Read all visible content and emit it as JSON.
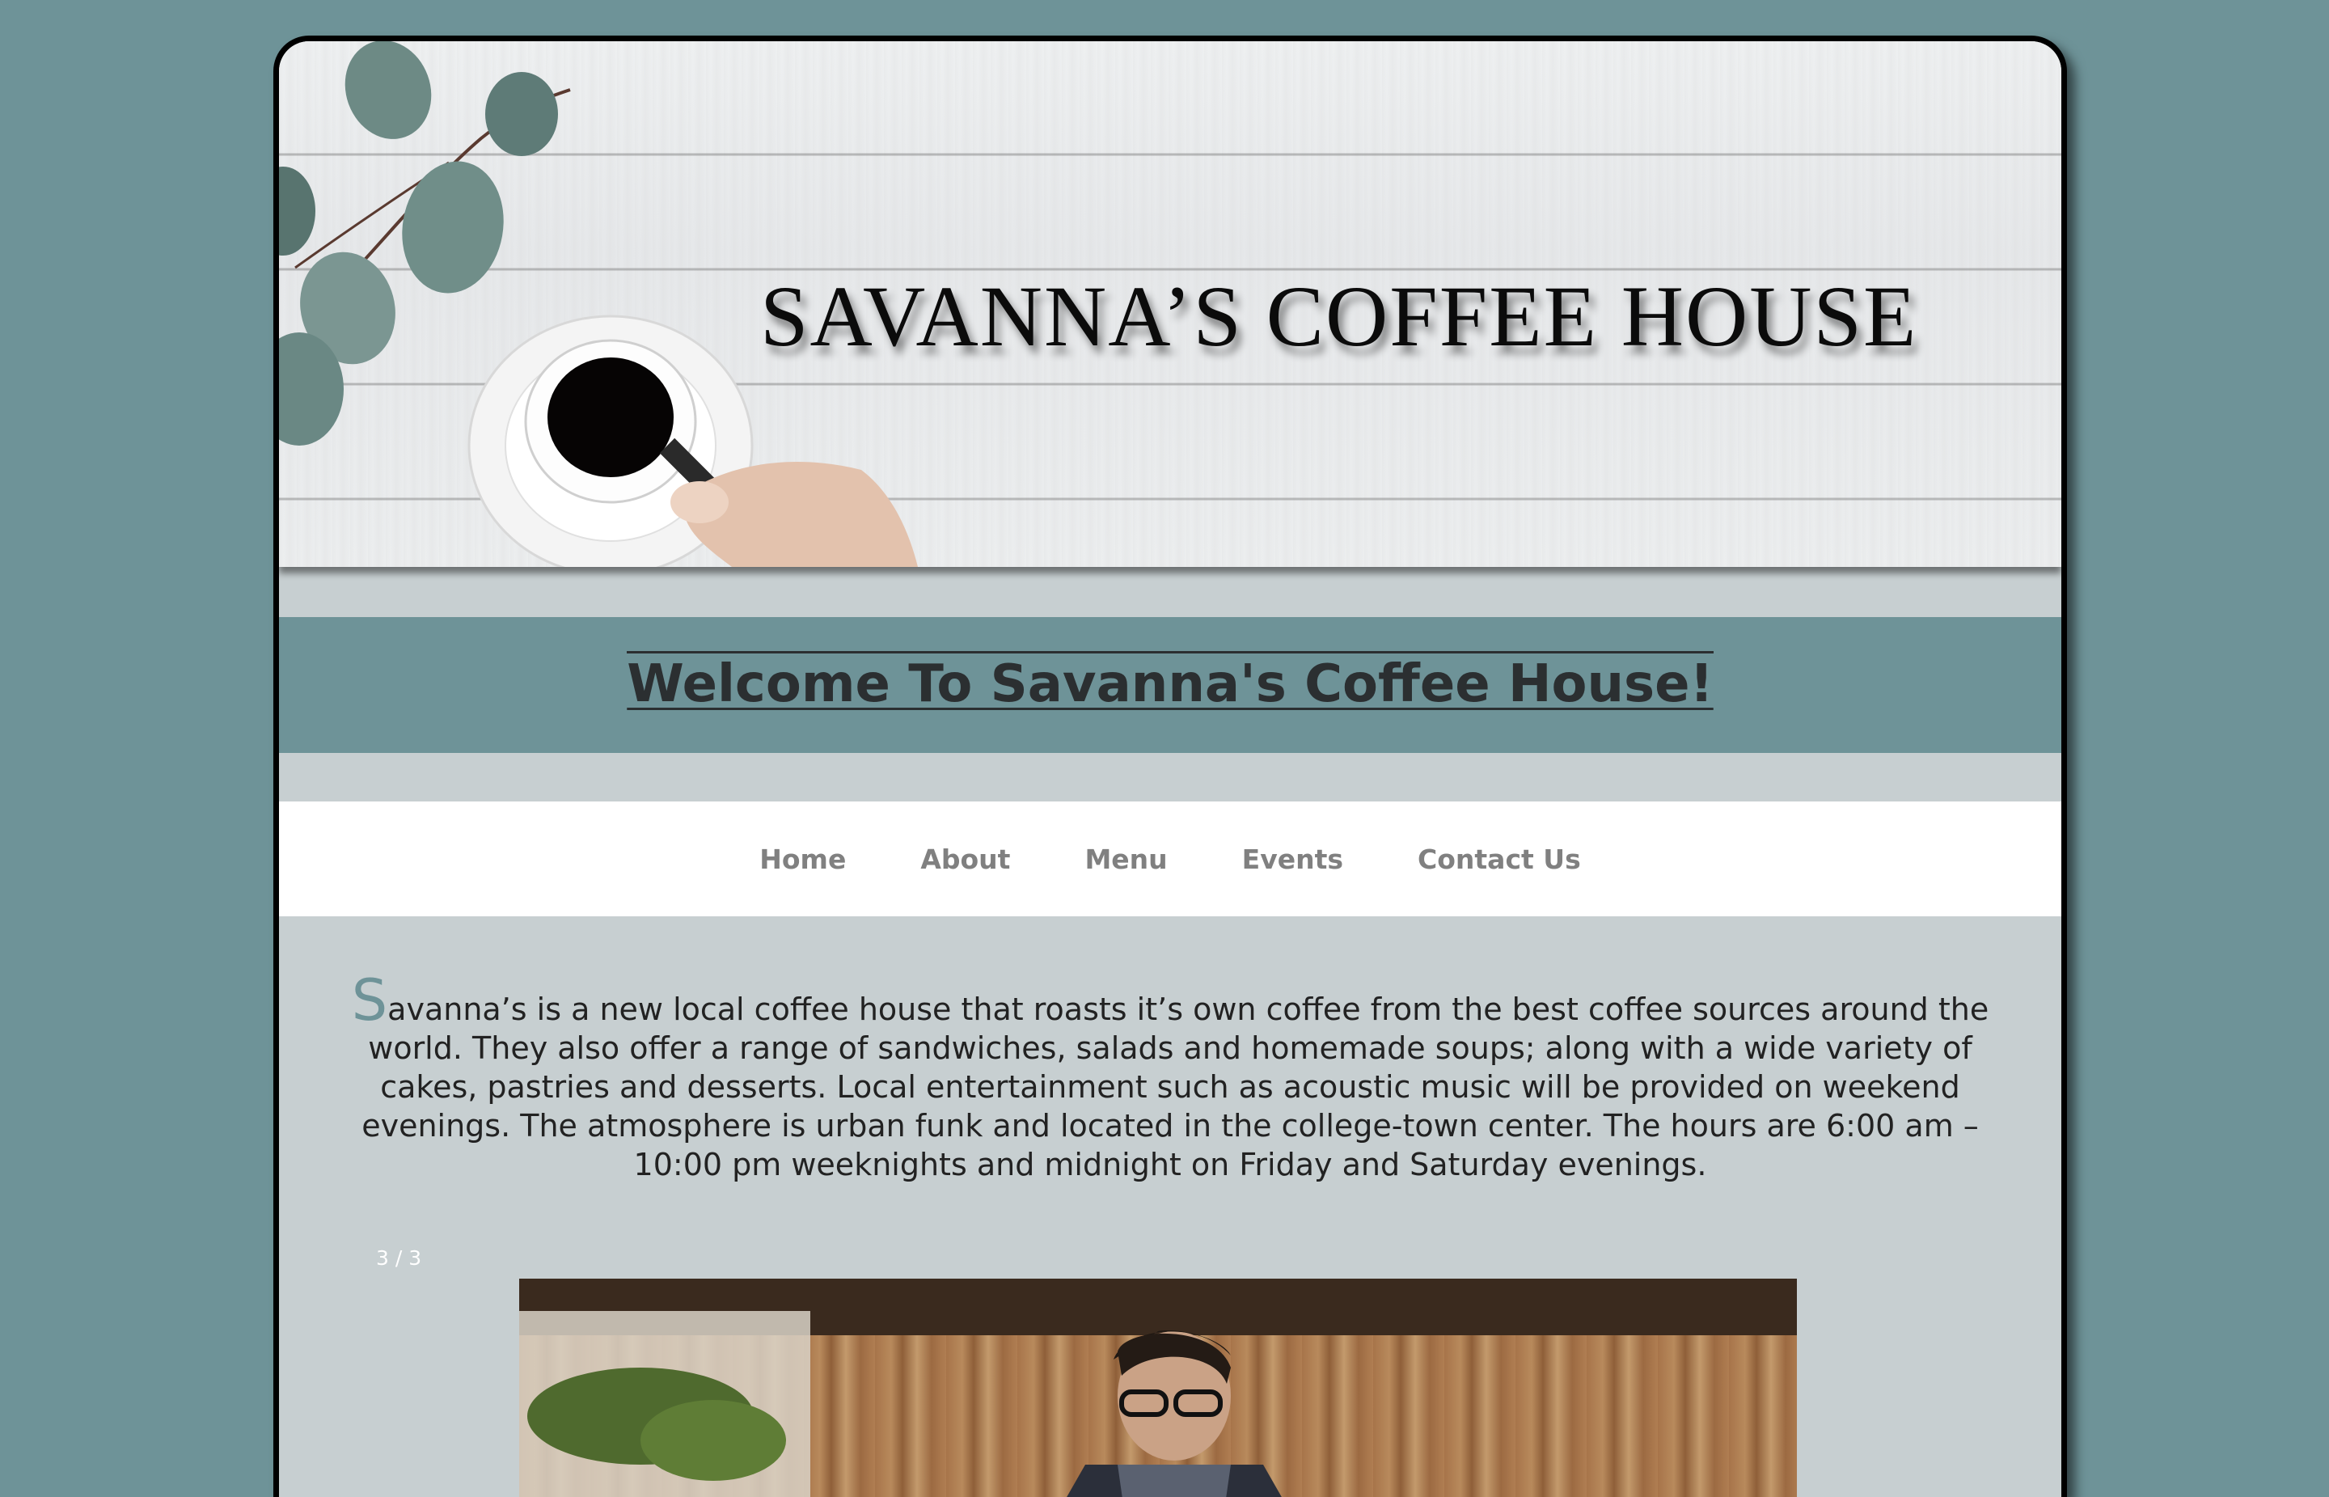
{
  "banner": {
    "title": "SAVANNA’S COFFEE HOUSE",
    "image": "coffee-cup-on-white-wood-with-eucalyptus"
  },
  "welcome": {
    "heading": "Welcome To Savanna's Coffee House!"
  },
  "nav": {
    "items": [
      {
        "label": "Home"
      },
      {
        "label": "About"
      },
      {
        "label": "Menu"
      },
      {
        "label": "Events"
      },
      {
        "label": "Contact Us"
      }
    ]
  },
  "intro": {
    "drop_cap": "S",
    "text": "avanna’s is a new local coffee house that roasts it’s own coffee from the best coffee sources around the world. They also offer a range of sandwiches, salads and homemade soups; along with a wide variety of cakes, pastries and desserts. Local entertainment such as acoustic music will be provided on weekend evenings. The atmosphere is urban funk and located in the college-town center. The hours are 6:00 am – 10:00 pm weeknights and midnight on Friday and Saturday evenings."
  },
  "slideshow": {
    "counter": "3 / 3",
    "image": "barista-with-glasses-in-wooden-cafe"
  },
  "colors": {
    "background": "#6e9398",
    "content": "#c7cfd1",
    "nav_text": "#808080",
    "drop_cap": "#6e9398"
  }
}
